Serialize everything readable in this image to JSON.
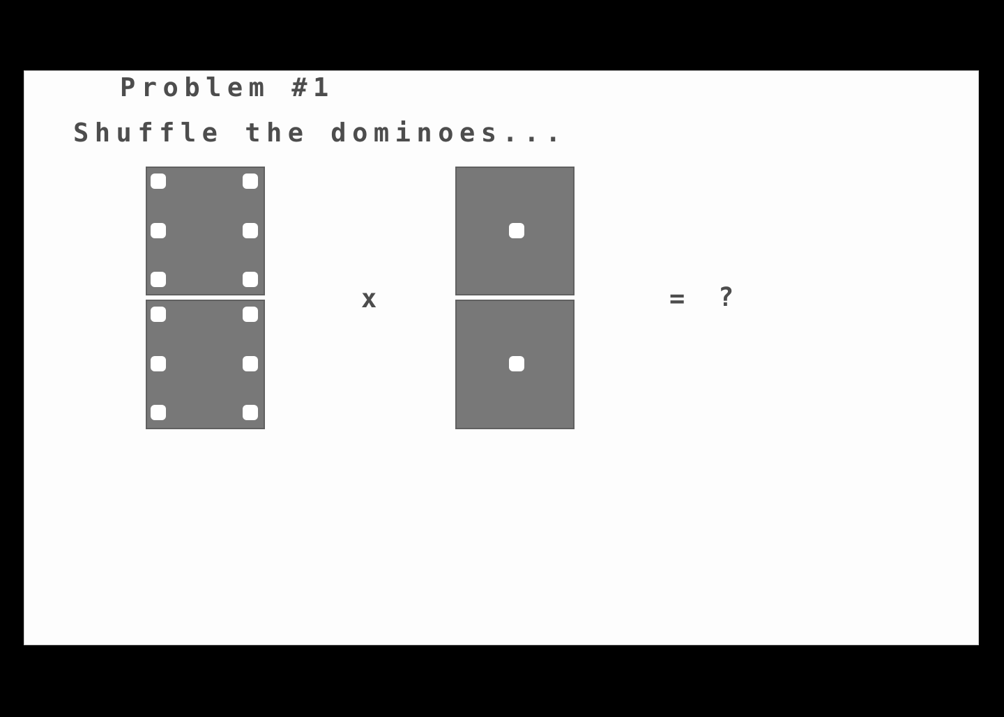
{
  "screen": {
    "heading": "Problem #1",
    "instruction": "Shuffle the dominoes...",
    "background_color": "#fdfdfd",
    "text_color": "#4d4d4d",
    "bezel_color": "#000000"
  },
  "equation": {
    "multiply_symbol": "x",
    "equals_symbol": "=",
    "result_placeholder": "?",
    "dominoes": [
      {
        "name": "left-domino",
        "top_pips": 6,
        "bottom_pips": 6,
        "face_color": "#787878",
        "pip_color": "#ffffff",
        "border_color": "#606060"
      },
      {
        "name": "right-domino",
        "top_pips": 1,
        "bottom_pips": 1,
        "face_color": "#787878",
        "pip_color": "#ffffff",
        "border_color": "#606060"
      }
    ]
  }
}
